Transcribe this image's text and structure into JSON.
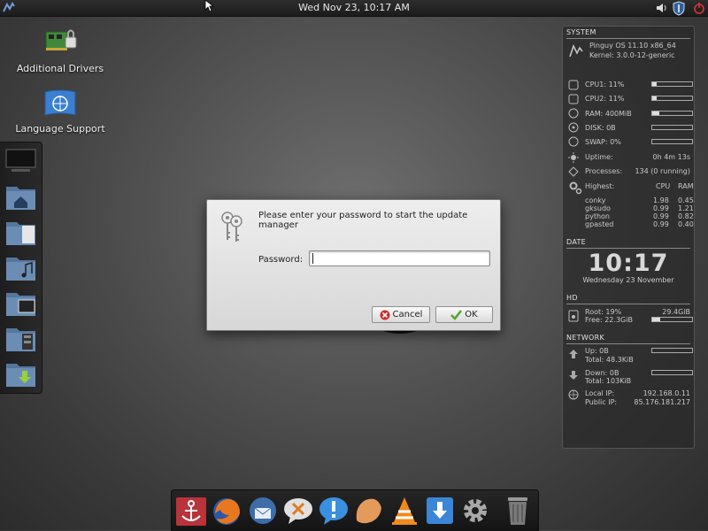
{
  "top_panel": {
    "clock": "Wed Nov 23, 10:17 AM",
    "icons": [
      "distro-logo-icon",
      "volume-icon",
      "shield-icon",
      "power-icon"
    ]
  },
  "desktop": {
    "icons": [
      {
        "label": "Additional Drivers",
        "icon": "drivers-icon"
      },
      {
        "label": "Language Support",
        "icon": "language-flag-icon"
      }
    ]
  },
  "left_dock": {
    "items": [
      "monitor-icon",
      "home-folder-icon",
      "documents-folder-icon",
      "music-folder-icon",
      "pictures-folder-icon",
      "videos-folder-icon",
      "downloads-folder-icon"
    ]
  },
  "conky": {
    "system_title": "SYSTEM",
    "os_line": "Pinguy OS 11.10 x86_64",
    "kernel_line": "Kernel: 3.0.0-12-generic",
    "cpu1": "CPU1: 11%",
    "cpu1_level": 0.11,
    "cpu2": "CPU2: 11%",
    "cpu2_level": 0.11,
    "ram": "RAM: 400MiB",
    "ram_level": 0.18,
    "disk": "DISK: 0B",
    "swap": "SWAP: 0%",
    "uptime_label": "Uptime:",
    "uptime_value": "0h 4m 13s",
    "processes_label": "Processes:",
    "processes_value": "134 (0 running)",
    "highest_label": "Highest:",
    "col_cpu": "CPU",
    "col_ram": "RAM",
    "top_procs": [
      {
        "name": "conky",
        "cpu": "1.98",
        "ram": "0.45"
      },
      {
        "name": "gksudo",
        "cpu": "0.99",
        "ram": "1.21"
      },
      {
        "name": "python",
        "cpu": "0.99",
        "ram": "0.82"
      },
      {
        "name": "gpasted",
        "cpu": "0.99",
        "ram": "0.40"
      }
    ],
    "date_title": "DATE",
    "time": "10:17",
    "date": "Wednesday 23 November",
    "hd_title": "HD",
    "root": "Root: 19%",
    "root_size": "29.4GiB",
    "free": "Free: 22.3GiB",
    "root_level": 0.19,
    "network_title": "NETWORK",
    "up": "Up: 0B",
    "up_total": "Total: 48.3KiB",
    "down": "Down: 0B",
    "down_total": "Total: 103KiB",
    "local_ip_label": "Local IP:",
    "local_ip": "192.168.0.11",
    "public_ip_label": "Public IP:",
    "public_ip": "85.176.181.217"
  },
  "dialog": {
    "message": "Please enter your password to start the update manager",
    "password_label": "Password:",
    "password_value": "",
    "cancel_label": "Cancel",
    "ok_label": "OK"
  },
  "bottom_dock": {
    "items": [
      "anchor-icon",
      "firefox-icon",
      "thunderbird-icon",
      "chat-icon",
      "empathy-icon",
      "pidgin-icon",
      "vlc-icon",
      "download-icon",
      "settings-gear-icon",
      "trash-icon"
    ]
  },
  "colors": {
    "accent_ok": "#5aa02c",
    "accent_cancel": "#cc2b2b"
  }
}
